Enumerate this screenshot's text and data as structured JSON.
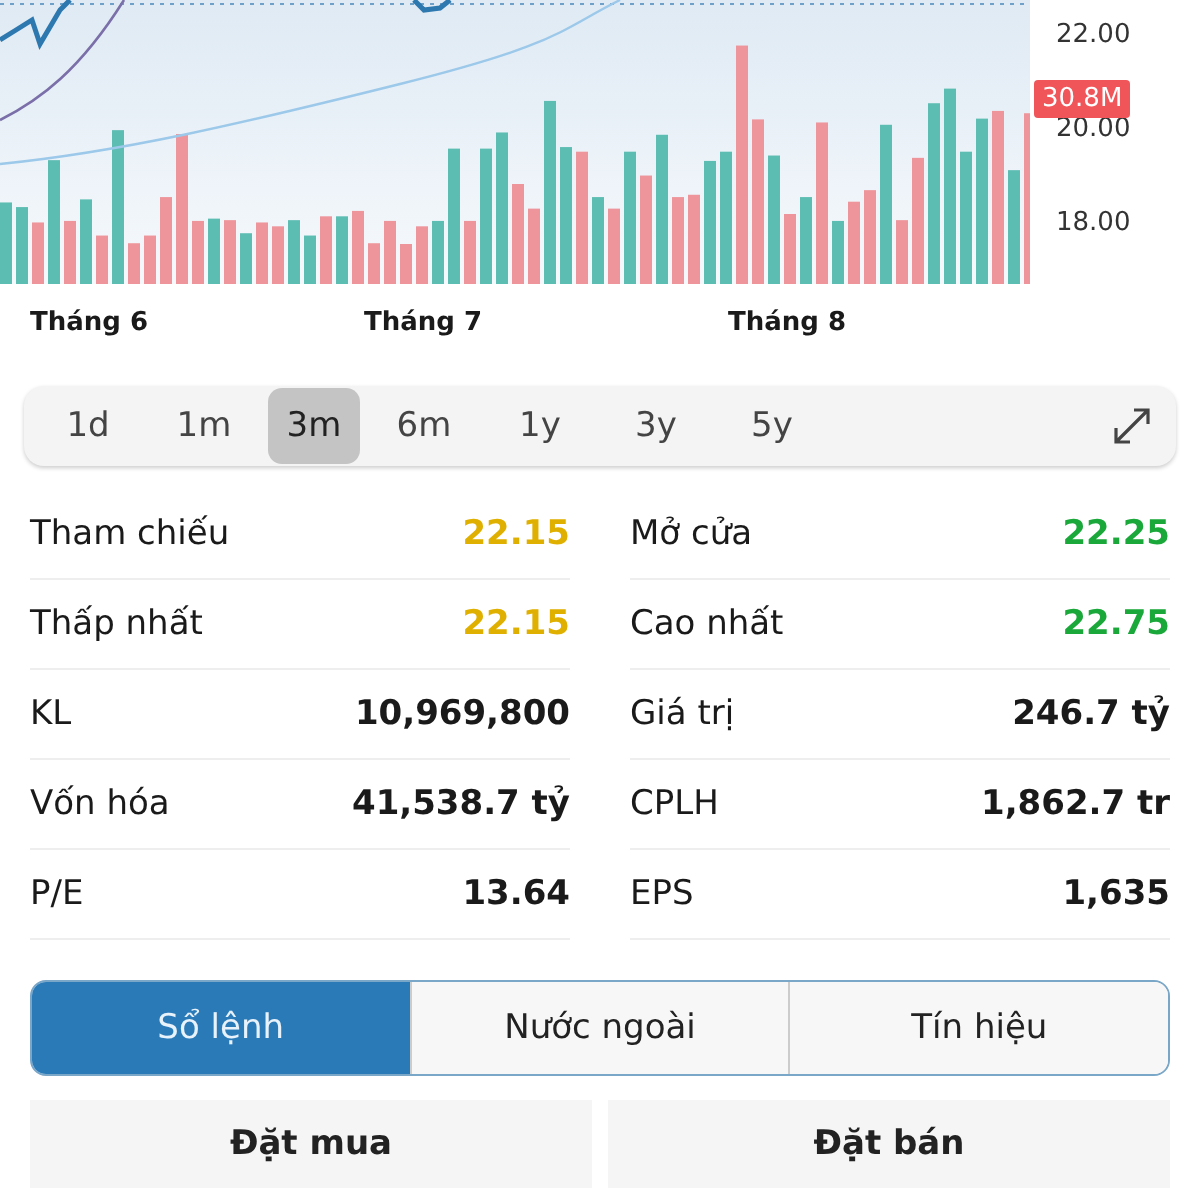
{
  "chart": {
    "price_labels": [
      "22.00",
      "20.00",
      "18.00"
    ],
    "volume_badge": "30.8M",
    "months": [
      "Tháng 6",
      "Tháng 7",
      "Tháng 8"
    ]
  },
  "periods": [
    {
      "label": "1d",
      "selected": false
    },
    {
      "label": "1m",
      "selected": false
    },
    {
      "label": "3m",
      "selected": true
    },
    {
      "label": "6m",
      "selected": false
    },
    {
      "label": "1y",
      "selected": false
    },
    {
      "label": "3y",
      "selected": false
    },
    {
      "label": "5y",
      "selected": false
    }
  ],
  "stats": [
    {
      "left": {
        "label": "Tham chiếu",
        "value": "22.15",
        "color": "#e0b000"
      },
      "right": {
        "label": "Mở cửa",
        "value": "22.25",
        "color": "#1aa83a"
      }
    },
    {
      "left": {
        "label": "Thấp nhất",
        "value": "22.15",
        "color": "#e0b000"
      },
      "right": {
        "label": "Cao nhất",
        "value": "22.75",
        "color": "#1aa83a"
      }
    },
    {
      "left": {
        "label": "KL",
        "value": "10,969,800",
        "color": "#1a1a1a"
      },
      "right": {
        "label": "Giá trị",
        "value": "246.7 tỷ",
        "color": "#1a1a1a"
      }
    },
    {
      "left": {
        "label": "Vốn hóa",
        "value": "41,538.7 tỷ",
        "color": "#1a1a1a"
      },
      "right": {
        "label": "CPLH",
        "value": "1,862.7 tr",
        "color": "#1a1a1a"
      }
    },
    {
      "left": {
        "label": "P/E",
        "value": "13.64",
        "color": "#1a1a1a"
      },
      "right": {
        "label": "EPS",
        "value": "1,635",
        "color": "#1a1a1a"
      }
    }
  ],
  "tabs": [
    {
      "label": "Sổ lệnh",
      "selected": true
    },
    {
      "label": "Nước ngoài",
      "selected": false
    },
    {
      "label": "Tín hiệu",
      "selected": false
    }
  ],
  "buttons": [
    "Đặt mua",
    "Đặt bán"
  ]
}
